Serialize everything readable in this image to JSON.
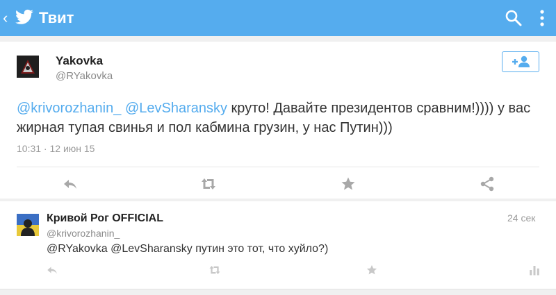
{
  "appbar": {
    "title": "Твит",
    "back_icon": "chevron-left-icon",
    "logo_icon": "twitter-bird-icon",
    "search_icon": "search-icon",
    "menu_icon": "overflow-menu-icon",
    "color": "#55acee"
  },
  "tweet": {
    "author_name": "Yakovka",
    "author_handle": "@RYakovka",
    "follow_icon": "follow-user-icon",
    "mention1": "@krivorozhanin_",
    "mention2": "@LevSharansky",
    "text": " круто! Давайте президентов сравним!)))) у вас жирная тупая свинья и пол кабмина грузин, у нас Путин)))",
    "timestamp": "10:31 · 12 июн 15",
    "actions": [
      "reply-icon",
      "retweet-icon",
      "favorite-icon",
      "share-icon"
    ]
  },
  "reply": {
    "author_name": "Кривой Рог OFFICIAL",
    "author_handle": "@krivorozhanin_",
    "time": "24 сек",
    "text": "@RYakovka @LevSharansky путин это тот, что хуйло?)",
    "actions": [
      "reply-icon",
      "retweet-icon",
      "favorite-icon",
      "stats-icon"
    ]
  },
  "colors": {
    "accent": "#55acee",
    "icon_gray": "#a8a8a8"
  }
}
